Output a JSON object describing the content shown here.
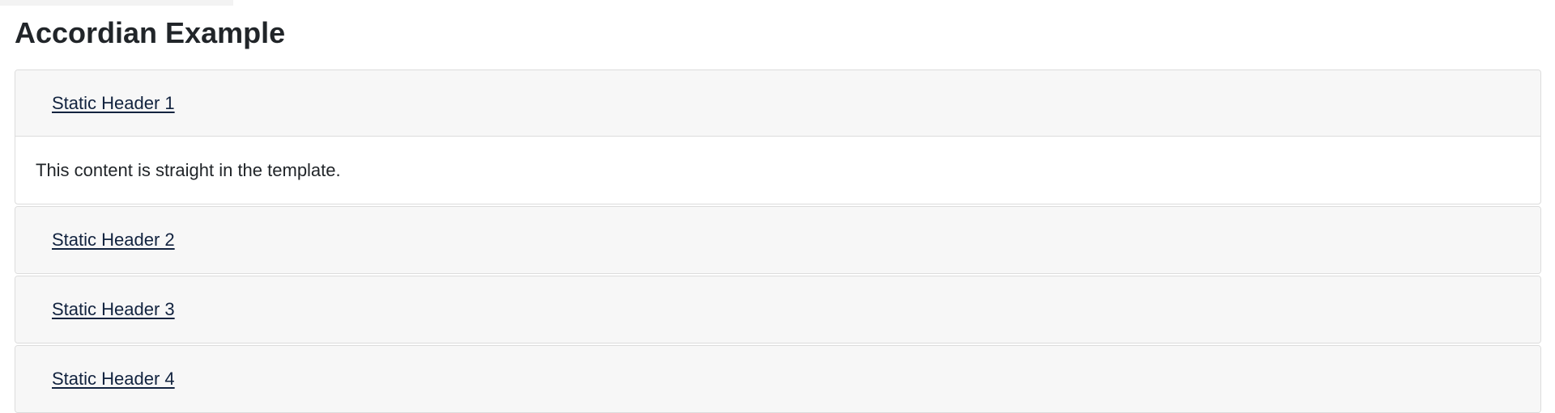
{
  "page": {
    "title": "Accordian Example"
  },
  "accordion": {
    "panels": [
      {
        "header": "Static Header 1",
        "content": "This content is straight in the template.",
        "open": true
      },
      {
        "header": "Static Header 2",
        "open": false
      },
      {
        "header": "Static Header 3",
        "open": false
      },
      {
        "header": "Static Header 4",
        "open": false
      }
    ]
  },
  "colors": {
    "header_background": "#f7f7f7",
    "border": "#dcdcdc",
    "link_text": "#12233f",
    "body_text": "#212529"
  }
}
